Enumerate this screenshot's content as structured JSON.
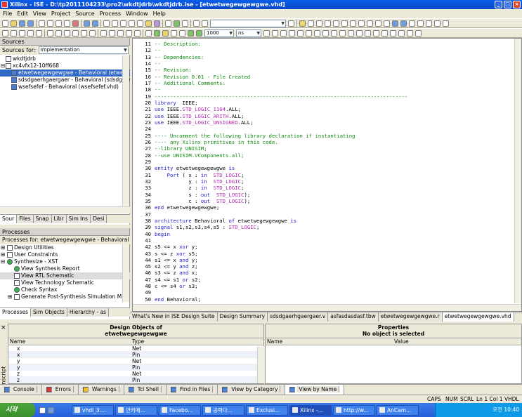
{
  "window": {
    "title": "Xilinx - ISE - D:\\tp2011104233\\pro2\\wkdtjdrb\\wkdtjdrb.ise - [etwetwegewgewgwe.vhd]"
  },
  "menu": [
    "File",
    "Edit",
    "View",
    "Project",
    "Source",
    "Process",
    "Window",
    "Help"
  ],
  "toolbar": {
    "zoom_value": "1000",
    "unit_value": "ns"
  },
  "sources": {
    "title": "Sources",
    "for_label": "Sources for:",
    "for_value": "Implementation",
    "tree": [
      {
        "label": "wkdtjdrb",
        "indent": 1,
        "icon": "project-icon"
      },
      {
        "label": "xc4vfx12-10ff668",
        "indent": 1,
        "icon": "device-icon",
        "expander": "⊟"
      },
      {
        "label": "etwetwegewgewgwe - Behavioral (etwetw",
        "indent": 2,
        "icon": "vhdl-top-icon",
        "selected": true
      },
      {
        "label": "sdsdgaerhgaergaer - Behavioral (sdsdgaerh",
        "indent": 2,
        "icon": "vhdl-file-icon"
      },
      {
        "label": "wsefsefef - Behavioral (wsefsefef.vhd)",
        "indent": 2,
        "icon": "vhdl-file-icon"
      }
    ],
    "tabs": [
      "Sour",
      "Files",
      "Snap",
      "Libr",
      "Sim Ins",
      "Desi"
    ]
  },
  "processes": {
    "title": "Processes",
    "for_label": "Processes for: etwetwegewgewgwe - Behavioral",
    "items": [
      {
        "label": "Design Utilities",
        "indent": 1,
        "expander": "⊞"
      },
      {
        "label": "User Constraints",
        "indent": 1,
        "expander": "⊞"
      },
      {
        "label": "Synthesize - XST",
        "indent": 1,
        "expander": "⊟",
        "status": "ok"
      },
      {
        "label": "View Synthesis Report",
        "indent": 2,
        "status": "ok"
      },
      {
        "label": "View RTL Schematic",
        "indent": 2,
        "highlight": true
      },
      {
        "label": "View Technology Schematic",
        "indent": 2
      },
      {
        "label": "Check Syntax",
        "indent": 2,
        "status": "ok"
      },
      {
        "label": "Generate Post-Synthesis Simulation M",
        "indent": 2,
        "expander": "⊞"
      }
    ],
    "tabs": [
      "Processes",
      "Sim Objects",
      "Hierarchy - as"
    ]
  },
  "editor": {
    "lines": [
      {
        "n": "11",
        "segs": [
          [
            "cm",
            "-- Description:"
          ]
        ]
      },
      {
        "n": "12",
        "segs": [
          [
            "cm",
            "--"
          ]
        ]
      },
      {
        "n": "13",
        "segs": [
          [
            "cm",
            "-- Dependencies:"
          ]
        ]
      },
      {
        "n": "14",
        "segs": [
          [
            "cm",
            "--"
          ]
        ]
      },
      {
        "n": "15",
        "segs": [
          [
            "cm",
            "-- Revision:"
          ]
        ]
      },
      {
        "n": "16",
        "segs": [
          [
            "cm",
            "-- Revision 0.01 - File Created"
          ]
        ]
      },
      {
        "n": "17",
        "segs": [
          [
            "cm",
            "-- Additional Comments:"
          ]
        ]
      },
      {
        "n": "18",
        "segs": [
          [
            "cm",
            "--"
          ]
        ]
      },
      {
        "n": "19",
        "segs": [
          [
            "cm",
            "----------------------------------------------------------------------------------"
          ]
        ]
      },
      {
        "n": "20",
        "segs": [
          [
            "kw",
            "library"
          ],
          [
            "",
            "  IEEE;"
          ]
        ]
      },
      {
        "n": "21",
        "segs": [
          [
            "kw",
            "use"
          ],
          [
            "",
            " IEEE."
          ],
          [
            "ty",
            "STD_LOGIC_1164"
          ],
          [
            "",
            ".ALL;"
          ]
        ]
      },
      {
        "n": "22",
        "segs": [
          [
            "kw",
            "use"
          ],
          [
            "",
            " IEEE."
          ],
          [
            "ty",
            "STD_LOGIC_ARITH"
          ],
          [
            "",
            ".ALL;"
          ]
        ]
      },
      {
        "n": "23",
        "segs": [
          [
            "kw",
            "use"
          ],
          [
            "",
            " IEEE."
          ],
          [
            "ty",
            "STD_LOGIC_UNSIGNED"
          ],
          [
            "",
            ".ALL;"
          ]
        ]
      },
      {
        "n": "24",
        "segs": [
          [
            "",
            ""
          ]
        ]
      },
      {
        "n": "25",
        "segs": [
          [
            "cm",
            "---- Uncomment the following library declaration if instantiating"
          ]
        ]
      },
      {
        "n": "26",
        "segs": [
          [
            "cm",
            "---- any Xilinx primitives in this code."
          ]
        ]
      },
      {
        "n": "27",
        "segs": [
          [
            "cm",
            "--library UNISIM;"
          ]
        ]
      },
      {
        "n": "28",
        "segs": [
          [
            "cm",
            "--use UNISIM.VComponents.all;"
          ]
        ]
      },
      {
        "n": "29",
        "segs": [
          [
            "",
            ""
          ]
        ]
      },
      {
        "n": "30",
        "segs": [
          [
            "kw",
            "entity"
          ],
          [
            "",
            " etwetwegewgewgwe "
          ],
          [
            "kw",
            "is"
          ]
        ]
      },
      {
        "n": "31",
        "segs": [
          [
            "",
            "    "
          ],
          [
            "kw",
            "Port"
          ],
          [
            "",
            " ( x : "
          ],
          [
            "kw",
            "in"
          ],
          [
            "",
            "  "
          ],
          [
            "ty",
            "STD_LOGIC"
          ],
          [
            "",
            ";"
          ]
        ]
      },
      {
        "n": "32",
        "segs": [
          [
            "",
            "           y : "
          ],
          [
            "kw",
            "in"
          ],
          [
            "",
            "  "
          ],
          [
            "ty",
            "STD_LOGIC"
          ],
          [
            "",
            ";"
          ]
        ]
      },
      {
        "n": "33",
        "segs": [
          [
            "",
            "           z : "
          ],
          [
            "kw",
            "in"
          ],
          [
            "",
            "  "
          ],
          [
            "ty",
            "STD_LOGIC"
          ],
          [
            "",
            ";"
          ]
        ]
      },
      {
        "n": "34",
        "segs": [
          [
            "",
            "           s : "
          ],
          [
            "kw",
            "out"
          ],
          [
            "",
            "  "
          ],
          [
            "ty",
            "STD_LOGIC"
          ],
          [
            "",
            ");"
          ]
        ]
      },
      {
        "n": "35",
        "segs": [
          [
            "",
            "           c : "
          ],
          [
            "kw",
            "out"
          ],
          [
            "",
            "  "
          ],
          [
            "ty",
            "STD_LOGIC"
          ],
          [
            "",
            ");"
          ]
        ]
      },
      {
        "n": "36",
        "segs": [
          [
            "kw",
            "end"
          ],
          [
            "",
            " etwetwegewgewgwe;"
          ]
        ]
      },
      {
        "n": "37",
        "segs": [
          [
            "",
            ""
          ]
        ]
      },
      {
        "n": "38",
        "segs": [
          [
            "kw",
            "architecture"
          ],
          [
            "",
            " Behavioral "
          ],
          [
            "kw",
            "of"
          ],
          [
            "",
            " etwetwegewgewgwe "
          ],
          [
            "kw",
            "is"
          ]
        ]
      },
      {
        "n": "39",
        "segs": [
          [
            "kw",
            "signal"
          ],
          [
            "",
            " s1,s2,s3,s4,s5 : "
          ],
          [
            "ty",
            "STD_LOGIC"
          ],
          [
            "",
            ";"
          ]
        ]
      },
      {
        "n": "40",
        "segs": [
          [
            "kw",
            "begin"
          ]
        ]
      },
      {
        "n": "41",
        "segs": [
          [
            "",
            ""
          ]
        ]
      },
      {
        "n": "42",
        "segs": [
          [
            "",
            "s5 <= x "
          ],
          [
            "kw",
            "xor"
          ],
          [
            "",
            " y;"
          ]
        ]
      },
      {
        "n": "43",
        "segs": [
          [
            "",
            "s <= z "
          ],
          [
            "kw",
            "xor"
          ],
          [
            "",
            " s5;"
          ]
        ]
      },
      {
        "n": "44",
        "segs": [
          [
            "",
            "s1 <= x "
          ],
          [
            "kw",
            "and"
          ],
          [
            "",
            " y;"
          ]
        ]
      },
      {
        "n": "45",
        "segs": [
          [
            "",
            "s2 <= y "
          ],
          [
            "kw",
            "and"
          ],
          [
            "",
            " z;"
          ]
        ]
      },
      {
        "n": "46",
        "segs": [
          [
            "",
            "s3 <= z "
          ],
          [
            "kw",
            "and"
          ],
          [
            "",
            " x;"
          ]
        ]
      },
      {
        "n": "47",
        "segs": [
          [
            "",
            "s4 <= s1 "
          ],
          [
            "kw",
            "or"
          ],
          [
            "",
            " s2;"
          ]
        ]
      },
      {
        "n": "48",
        "segs": [
          [
            "",
            "c <= s4 "
          ],
          [
            "kw",
            "or"
          ],
          [
            "",
            " s3;"
          ]
        ]
      },
      {
        "n": "49",
        "segs": [
          [
            "",
            ""
          ]
        ]
      },
      {
        "n": "50",
        "segs": [
          [
            "kw",
            "end"
          ],
          [
            "",
            " Behavioral;"
          ]
        ]
      }
    ]
  },
  "doc_tabs": [
    "What's New in ISE Design Suite",
    "Design Summary",
    "sdsdgaerhgaergaer.v",
    "asfasdasdasf.tbw",
    "etwetwegewgewgwe.r",
    "etwetwegewgewgwe.vhd"
  ],
  "design_objects": {
    "title": "Design Objects of",
    "subtitle": "etwetwegewgewgwe",
    "col_name": "Name",
    "col_type": "Type",
    "rows": [
      {
        "name": "x",
        "type": "Net"
      },
      {
        "name": "x",
        "type": "Pin"
      },
      {
        "name": "y",
        "type": "Net"
      },
      {
        "name": "y",
        "type": "Pin"
      },
      {
        "name": "z",
        "type": "Net"
      },
      {
        "name": "z",
        "type": "Pin"
      }
    ]
  },
  "properties": {
    "title": "Properties",
    "subtitle": "No object is selected",
    "col_name": "Name",
    "col_value": "Value"
  },
  "transcript_label": "Transcript",
  "bottom_tabs": [
    "Console",
    "Errors",
    "Warnings",
    "Tcl Shell",
    "Find in Files",
    "View by Category",
    "View by Name"
  ],
  "status": {
    "caps": "CAPS",
    "num": "NUM",
    "scrl": "SCRL",
    "pos": "Ln 1 Col 1",
    "lang": "VHDL"
  },
  "taskbar": {
    "start": "시작",
    "tasks": [
      "vhdl_3....",
      "안키메...",
      "Facebo...",
      "공력다...",
      "Exclusi...",
      "Xilinx -...",
      "http://w...",
      "AnCam..."
    ],
    "time": "오전 10:40"
  }
}
